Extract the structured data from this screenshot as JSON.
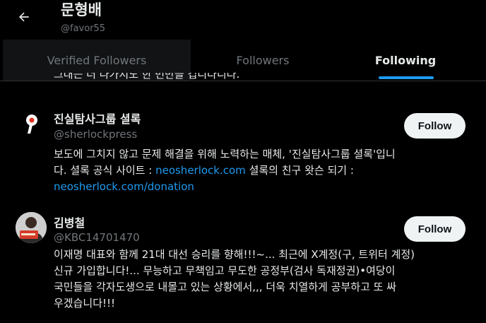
{
  "header": {
    "profile_name": "문형배",
    "profile_handle": "@favor55",
    "back_icon": "arrow-left-icon"
  },
  "tabs": [
    {
      "label": "Verified Followers",
      "active": false
    },
    {
      "label": "Followers",
      "active": false
    },
    {
      "label": "Following",
      "active": true
    }
  ],
  "colors": {
    "background": "#000000",
    "text_primary": "#e7e9ea",
    "text_secondary": "#71767b",
    "accent": "#1d9bf0",
    "follow_button_bg": "#eff3f4"
  },
  "clipped_previous_bio": "그대는 더 나가지도 한 번만을 겁니다니다.",
  "users": [
    {
      "name": "진실탐사그룹 셜록",
      "handle": "@sherlockpress",
      "follow_label": "Follow",
      "avatar_icon": "sherlock-logo-icon",
      "bio_line1": "보도에 그치지 않고 문제 해결을 위해 노력하는 매체, '진실탐사그룹 셜록'입니",
      "bio_line2_prefix": "다. 셜록 공식 사이트 : ",
      "bio_line2_link": "neosherlock.com",
      "bio_line2_suffix": " 셜록의 친구 왓슨 되기 :",
      "bio_line3_link": "neosherlock.com/donation"
    },
    {
      "name": "김병철",
      "handle": "@KBC14701470",
      "follow_label": "Follow",
      "avatar_icon": "user-photo-avatar",
      "bio_line1": "이재명 대표와 함께 21대 대선 승리를 향해!!!~... 최근에 X계정(구, 트위터 계정)",
      "bio_line2": "신규 가입합니다!... 무능하고 무책임고 무도한 공정부(검사 독재정권)•여당이",
      "bio_line3": "국민들을 각자도생으로 내몰고 있는 상황에서,,, 더욱 치열하게 공부하고 또 싸",
      "bio_line4": "우겠습니다!!!"
    }
  ]
}
